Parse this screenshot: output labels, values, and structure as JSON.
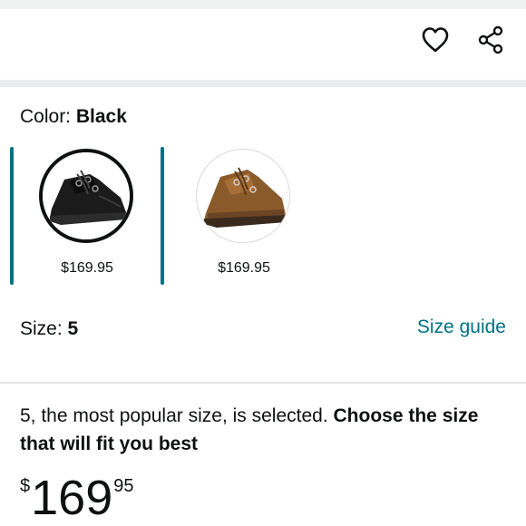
{
  "icons": {
    "wishlist": "heart-outline-icon",
    "share": "share-icon"
  },
  "color_selector": {
    "label": "Color: ",
    "value": "Black",
    "options": [
      {
        "name": "Black",
        "price": "$169.95",
        "selected": true
      },
      {
        "name": "Brown",
        "price": "$169.95",
        "selected": false
      }
    ]
  },
  "size_selector": {
    "label": "Size: ",
    "value": "5",
    "guide_link": "Size guide"
  },
  "size_message": {
    "text": "5, the most popular size, is selected. ",
    "emphasis": "Choose the size that will fit you best"
  },
  "price": {
    "currency": "$",
    "whole": "169",
    "fraction": "95"
  },
  "colors": {
    "accent": "#007185",
    "text": "#0f1111",
    "divider": "#eaeded"
  }
}
